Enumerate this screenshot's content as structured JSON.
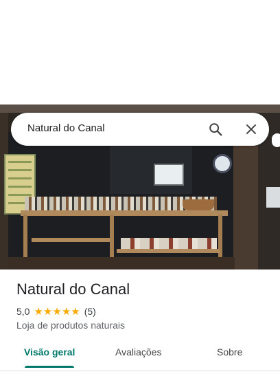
{
  "search": {
    "query": "Natural do Canal",
    "search_icon": "search-icon",
    "close_icon": "close-icon"
  },
  "photo": {
    "subject": "storefront-photo"
  },
  "place": {
    "name": "Natural do Canal",
    "rating": "5,0",
    "stars": 5,
    "review_count": "(5)",
    "category": "Loja de produtos naturais"
  },
  "tabs": [
    {
      "label": "Visão geral",
      "active": true
    },
    {
      "label": "Avaliações",
      "active": false
    },
    {
      "label": "Sobre",
      "active": false
    }
  ],
  "colors": {
    "accent": "#00796b",
    "star": "#f9ab00",
    "text_primary": "#202124",
    "text_secondary": "#5f6368"
  }
}
